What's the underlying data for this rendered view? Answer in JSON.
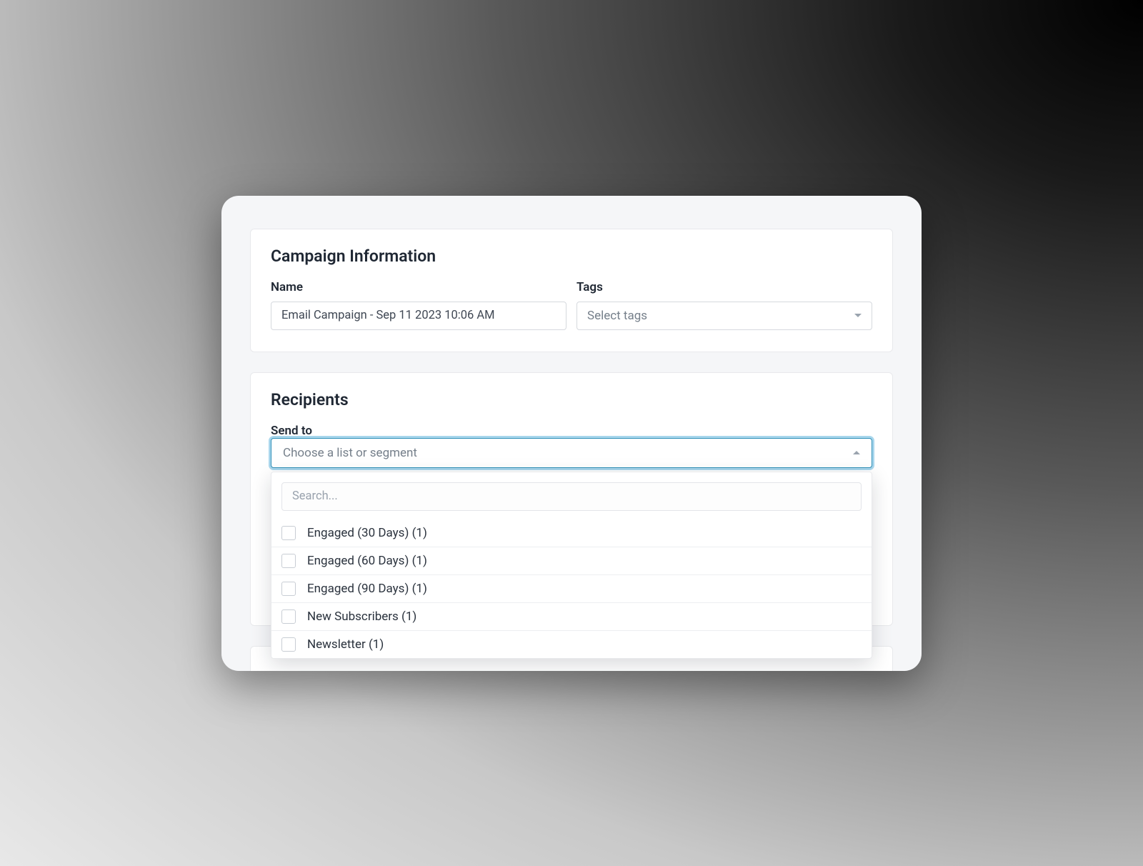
{
  "campaign_info": {
    "title": "Campaign Information",
    "name_label": "Name",
    "name_value": "Email Campaign - Sep 11 2023 10:06 AM",
    "tags_label": "Tags",
    "tags_placeholder": "Select tags"
  },
  "recipients": {
    "title": "Recipients",
    "send_to_label": "Send to",
    "send_to_placeholder": "Choose a list or segment",
    "search_placeholder": "Search...",
    "options": [
      {
        "label": "Engaged (30 Days) (1)"
      },
      {
        "label": "Engaged (60 Days) (1)"
      },
      {
        "label": "Engaged (90 Days) (1)"
      },
      {
        "label": "New Subscribers (1)"
      },
      {
        "label": "Newsletter (1)"
      }
    ]
  }
}
